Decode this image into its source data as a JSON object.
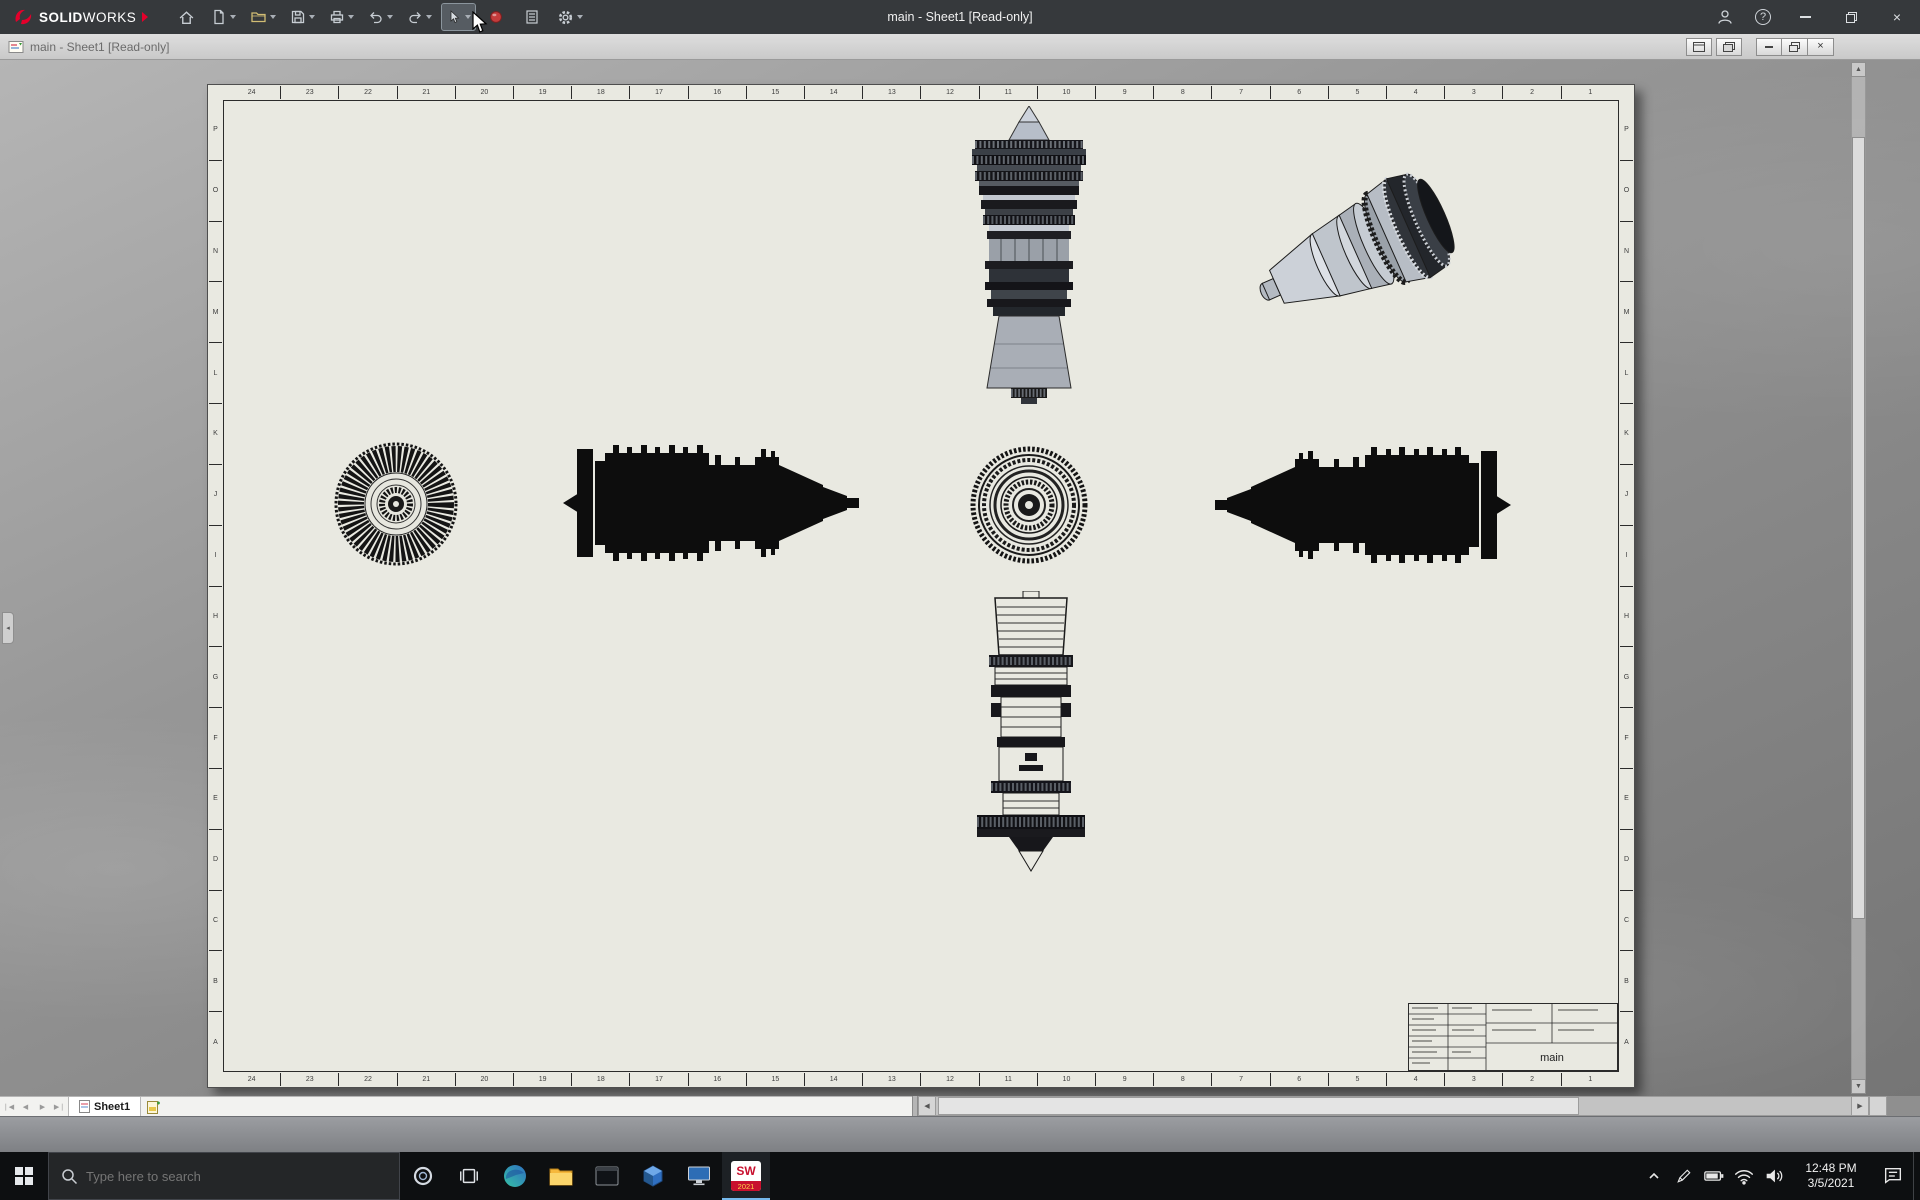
{
  "titlebar": {
    "brand_bold": "SOLID",
    "brand_light": "WORKS",
    "title": "main - Sheet1 [Read-only]"
  },
  "document_bar": {
    "title": "main - Sheet1 [Read-only]"
  },
  "toolbar": {
    "icons": [
      "home-icon",
      "new-document-icon",
      "open-folder-icon",
      "save-icon",
      "print-icon",
      "undo-icon",
      "redo-icon",
      "select-cursor-icon",
      "rebuild-icon",
      "file-properties-icon",
      "options-gear-icon",
      "account-icon",
      "help-icon",
      "minimize-icon",
      "restore-icon",
      "close-icon"
    ]
  },
  "drawing": {
    "zone_numbers": [
      "24",
      "23",
      "22",
      "21",
      "20",
      "19",
      "18",
      "17",
      "16",
      "15",
      "14",
      "13",
      "12",
      "11",
      "10",
      "9",
      "8",
      "7",
      "6",
      "5",
      "4",
      "3",
      "2",
      "1"
    ],
    "zone_letters": [
      "P",
      "O",
      "N",
      "M",
      "L",
      "K",
      "J",
      "I",
      "H",
      "G",
      "F",
      "E",
      "D",
      "C",
      "B",
      "A"
    ],
    "title_block_name": "main",
    "views": [
      "top-projected-view",
      "isometric-view",
      "front-fan-view",
      "left-side-view",
      "rear-view",
      "right-side-view",
      "bottom-projected-view"
    ]
  },
  "tabs": {
    "sheet_tab": "Sheet1"
  },
  "taskbar": {
    "search_placeholder": "Type here to search",
    "time": "12:48 PM",
    "date": "3/5/2021",
    "sw_label": "SW",
    "sw_year": "2021",
    "app_icons": [
      "start-icon",
      "cortana-icon",
      "task-view-icon",
      "edge-icon",
      "file-explorer-icon",
      "dark-window-app-icon",
      "cube-app-icon",
      "display-app-icon",
      "solidworks-app-icon"
    ],
    "tray_icons": [
      "hidden-icons-chevron",
      "pen-icon",
      "battery-icon",
      "wifi-icon",
      "volume-icon",
      "action-center-icon"
    ]
  }
}
